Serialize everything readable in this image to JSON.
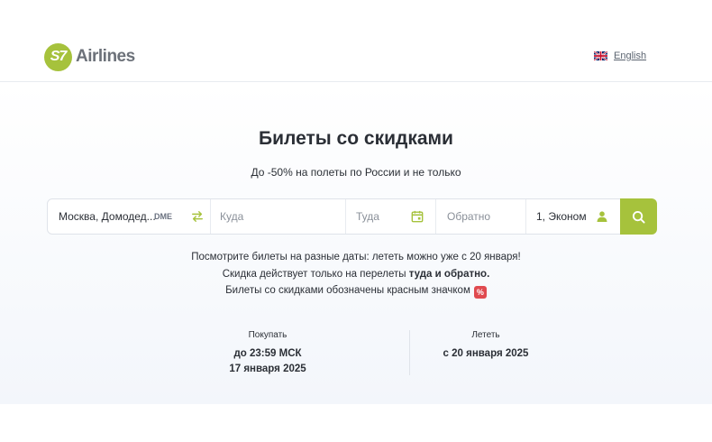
{
  "header": {
    "logo_badge": "S7",
    "logo_text": "Airlines",
    "language_label": "English",
    "language_flag_icon": "uk-flag-icon"
  },
  "hero": {
    "title": "Билеты со скидками",
    "subtitle": "До -50% на полеты по России и не только"
  },
  "search": {
    "from_value": "Москва, Домодед...",
    "from_code": "DME",
    "to_placeholder": "Куда",
    "date_there_placeholder": "Туда",
    "date_back_placeholder": "Обратно",
    "passengers_value": "1, Эконом",
    "icons": {
      "swap": "swap-arrows-icon",
      "calendar": "calendar-icon",
      "passenger": "person-icon",
      "search": "search-icon"
    }
  },
  "info": {
    "line1": "Посмотрите билеты на разные даты: лететь можно уже с 20 января!",
    "line2_prefix": "Скидка действует только на перелеты ",
    "line2_bold": "туда и обратно.",
    "line3": "Билеты со скидками обозначены красным значком",
    "badge": "%"
  },
  "periods": {
    "buy_label": "Покупать",
    "buy_line1": "до 23:59 МСК",
    "buy_line2": "17 января 2025",
    "fly_label": "Лететь",
    "fly_line1": "с 20 января 2025"
  },
  "colors": {
    "brand_green": "#a6c23c",
    "discount_red": "#e04a4f",
    "text": "#2b2f36"
  }
}
